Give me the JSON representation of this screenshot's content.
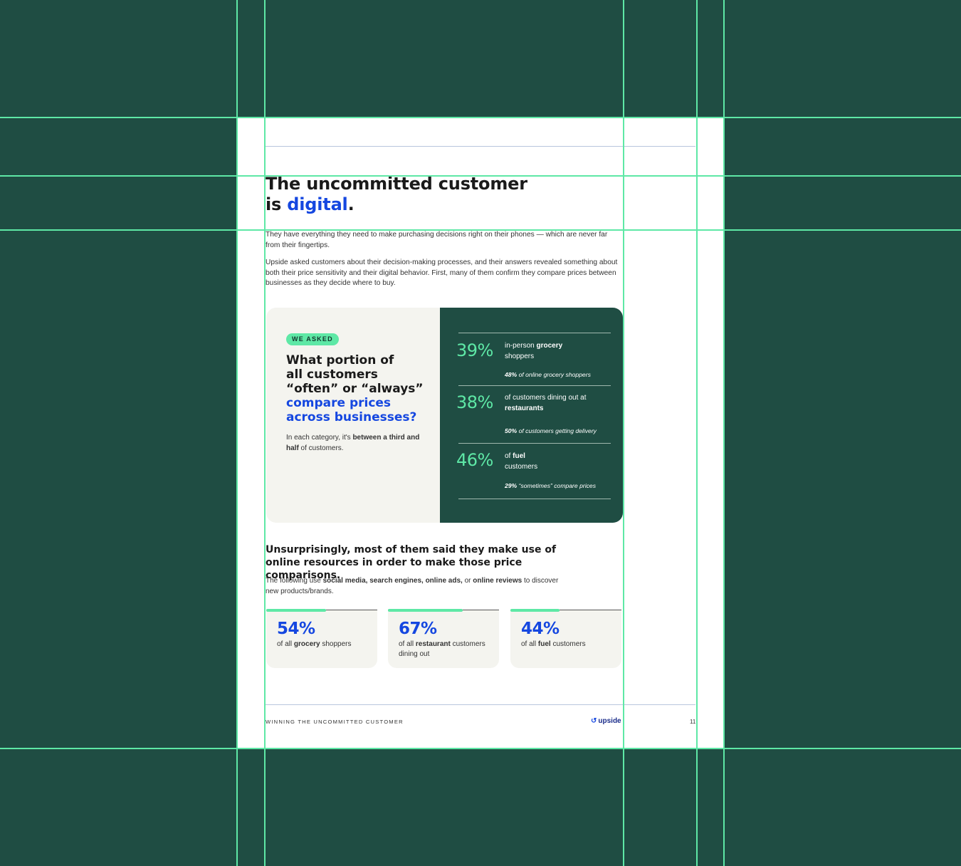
{
  "header": {
    "title_line1": "The uncommitted customer",
    "title_line2_prefix": "is ",
    "title_line2_accent": "digital",
    "title_line2_suffix": "."
  },
  "intro": {
    "p1": "They have everything they need to make purchasing decisions right on their phones — which are never far from their fingertips.",
    "p2": "Upside asked customers about their decision-making processes, and their answers revealed something about both their price sensitivity and their digital behavior. First, many of them confirm they compare prices between businesses as they decide where to buy."
  },
  "card": {
    "pill": "WE ASKED",
    "question_line1": "What portion of",
    "question_line2": "all customers",
    "question_line3": "“often” or “always”",
    "question_accent1": "compare prices",
    "question_accent2": "across businesses?",
    "note_pre": "In each category, it's ",
    "note_bold": "between a third and half",
    "note_post": " of customers.",
    "stats": [
      {
        "pct": "39%",
        "pre": "in-person ",
        "bold": "grocery",
        "post": " shoppers",
        "sub_bold": "48%",
        "sub": " of online grocery shoppers"
      },
      {
        "pct": "38%",
        "pre": "of customers dining out at ",
        "bold": "restaurants",
        "post": "",
        "sub_bold": "50%",
        "sub": " of customers getting delivery"
      },
      {
        "pct": "46%",
        "pre": "of ",
        "bold": "fuel",
        "post": " customers",
        "sub_bold": "29%",
        "sub": " “sometimes” compare prices"
      }
    ]
  },
  "section2": {
    "heading": "Unsurprisingly, most of them said they make use of online resources in order to make those price comparisons.",
    "sub_pre": "The following use ",
    "sub_b1": "social media, search engines, online ads,",
    "sub_mid": " or ",
    "sub_b2": "online reviews",
    "sub_post": " to discover new products/brands.",
    "boxes": [
      {
        "pct": "54%",
        "value": 0.54,
        "pre": "of all ",
        "bold": "grocery",
        "post": " shoppers"
      },
      {
        "pct": "67%",
        "value": 0.67,
        "pre": "of all ",
        "bold": "restaurant",
        "post": " customers dining out"
      },
      {
        "pct": "44%",
        "value": 0.44,
        "pre": "of all ",
        "bold": "fuel",
        "post": " customers"
      }
    ]
  },
  "footer": {
    "left": "WINNING THE UNCOMMITTED CUSTOMER",
    "logo": "upside",
    "page": "11"
  },
  "colors": {
    "background": "#1f4d43",
    "accent_blue": "#1547e0",
    "mint": "#5ee8a6",
    "card_dark": "#1f4d43",
    "card_light": "#f4f4ef"
  }
}
